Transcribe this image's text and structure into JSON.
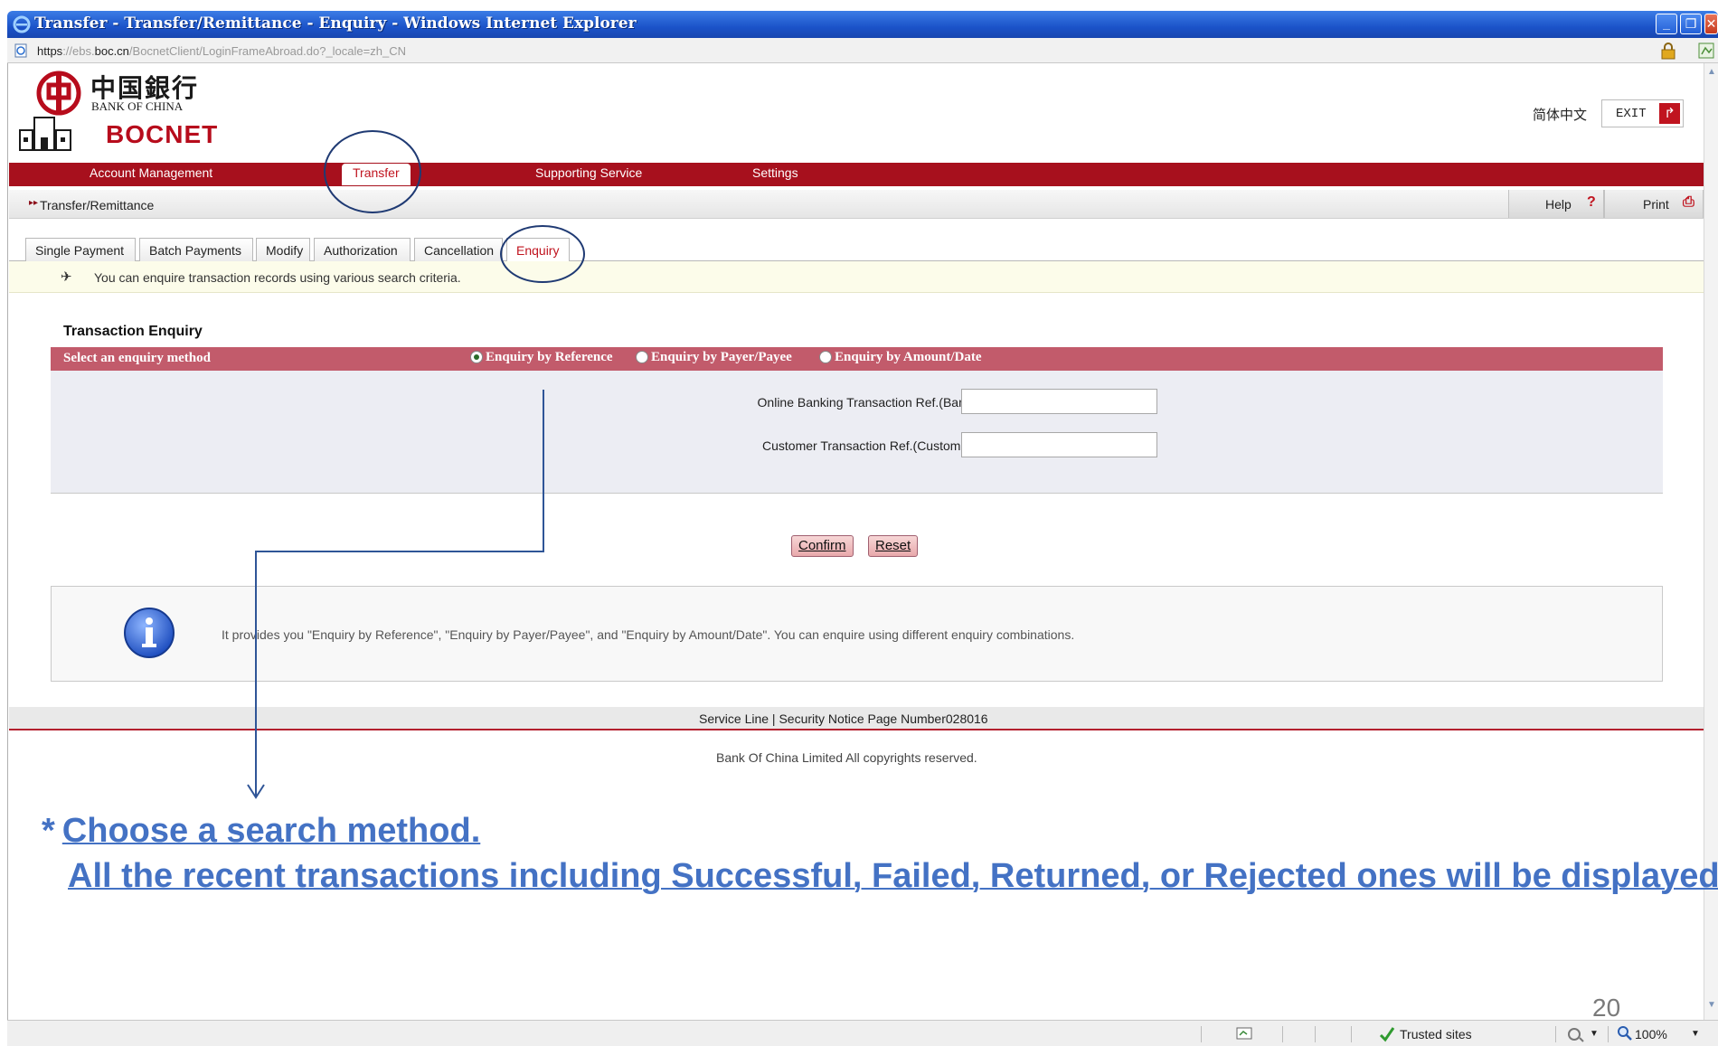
{
  "window": {
    "title": "Transfer - Transfer/Remittance - Enquiry - Windows Internet Explorer",
    "minimize_glyph": "_",
    "maximize_glyph": "❐",
    "close_glyph": "✕"
  },
  "address_bar": {
    "url_scheme": "https",
    "url_sep": "://",
    "url_host_prefix": "ebs.",
    "url_host": "boc.cn",
    "url_path": "/BocnetClient/LoginFrameAbroad.do?_locale=zh_CN"
  },
  "header": {
    "logo_cn": "中国銀行",
    "logo_en": "BANK OF CHINA",
    "product": "BOCNET",
    "language": "简体中文",
    "exit_label": "EXIT",
    "exit_icon": "↱"
  },
  "nav": {
    "items": [
      {
        "label": "Account Management"
      },
      {
        "label": "Transfer"
      },
      {
        "label": "Supporting Service"
      },
      {
        "label": "Settings"
      }
    ]
  },
  "breadcrumb": {
    "arrow": "▸▸",
    "text": "Transfer/Remittance",
    "help_label": "Help",
    "help_icon": "?",
    "print_label": "Print",
    "print_icon": "⎙"
  },
  "tabs": [
    {
      "label": "Single Payment"
    },
    {
      "label": "Batch Payments"
    },
    {
      "label": "Modify"
    },
    {
      "label": "Authorization"
    },
    {
      "label": "Cancellation"
    },
    {
      "label": "Enquiry"
    }
  ],
  "notice": {
    "pin_icon": "✈",
    "text": "You can enquire transaction records using various search criteria."
  },
  "enquiry": {
    "title": "Transaction Enquiry",
    "method_label": "Select an enquiry method",
    "methods": [
      {
        "label": "Enquiry by Reference"
      },
      {
        "label": "Enquiry by Payer/Payee"
      },
      {
        "label": "Enquiry by Amount/Date"
      }
    ],
    "selected_method": "Enquiry by Reference",
    "fields": [
      {
        "label": "Online Banking Transaction Ref.(Bank Ref.):",
        "value": ""
      },
      {
        "label": "Customer Transaction Ref.(Customer Ref.):",
        "value": ""
      }
    ],
    "confirm_label": "Confirm",
    "reset_label": "Reset"
  },
  "info": {
    "text": "It provides you \"Enquiry by Reference\", \"Enquiry by Payer/Payee\", and \"Enquiry by Amount/Date\". You can enquire using different enquiry combinations."
  },
  "footer": {
    "links": "Service Line   |   Security Notice    Page Number028016",
    "copyright": "Bank Of China Limited     All copyrights reserved."
  },
  "annotation": {
    "asterisk": "*",
    "line1": "Choose a search method.",
    "line2": "All the recent transactions including Successful, Failed, Returned, or Rejected ones will be displayed.",
    "slide_number": "20"
  },
  "statusbar": {
    "zone": "Trusted sites",
    "zoom": "100%"
  },
  "colors": {
    "brand_red": "#a7101d",
    "method_bar": "#c25b6b",
    "annotation_blue": "#4472c4",
    "annotation_circle": "#1f3a73"
  }
}
